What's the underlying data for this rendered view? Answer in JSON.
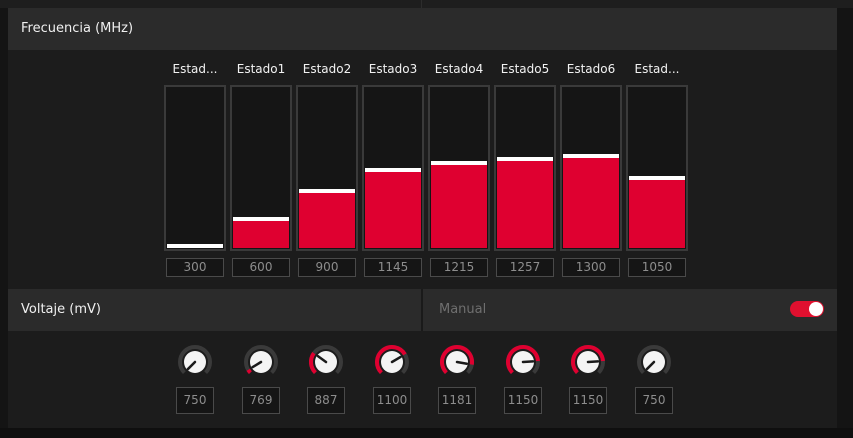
{
  "frequency": {
    "title": "Frecuencia (MHz)",
    "states": [
      {
        "label": "Estad...",
        "value": "300",
        "level": 0.0
      },
      {
        "label": "Estado1",
        "value": "600",
        "level": 0.175
      },
      {
        "label": "Estado2",
        "value": "900",
        "level": 0.35
      },
      {
        "label": "Estado3",
        "value": "1145",
        "level": 0.49
      },
      {
        "label": "Estado4",
        "value": "1215",
        "level": 0.53
      },
      {
        "label": "Estado5",
        "value": "1257",
        "level": 0.555
      },
      {
        "label": "Estado6",
        "value": "1300",
        "level": 0.58
      },
      {
        "label": "Estad...",
        "value": "1050",
        "level": 0.435
      }
    ]
  },
  "voltage": {
    "title": "Voltaje (mV)",
    "mode_label": "Manual",
    "toggle_on": true,
    "knobs": [
      {
        "value": "750",
        "level": 0.0
      },
      {
        "value": "769",
        "level": 0.05
      },
      {
        "value": "887",
        "level": 0.3
      },
      {
        "value": "1100",
        "level": 0.72
      },
      {
        "value": "1181",
        "level": 0.87
      },
      {
        "value": "1150",
        "level": 0.82
      },
      {
        "value": "1150",
        "level": 0.82
      },
      {
        "value": "750",
        "level": 0.0
      }
    ]
  },
  "colors": {
    "accent": "#df0030",
    "panel_header": "#2b2b2b",
    "panel_body": "#1c1c1c",
    "knob_track": "#3a3a3a"
  }
}
